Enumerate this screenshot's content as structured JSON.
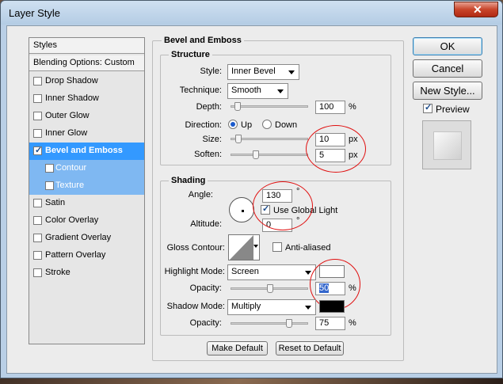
{
  "window": {
    "title": "Layer Style",
    "close_icon": "close-icon"
  },
  "styles": {
    "header": "Styles",
    "blending": "Blending Options: Custom",
    "items": [
      {
        "label": "Drop Shadow",
        "checked": false
      },
      {
        "label": "Inner Shadow",
        "checked": false
      },
      {
        "label": "Outer Glow",
        "checked": false
      },
      {
        "label": "Inner Glow",
        "checked": false
      },
      {
        "label": "Bevel and Emboss",
        "checked": true
      },
      {
        "label": "Contour",
        "checked": false
      },
      {
        "label": "Texture",
        "checked": false
      },
      {
        "label": "Satin",
        "checked": false
      },
      {
        "label": "Color Overlay",
        "checked": false
      },
      {
        "label": "Gradient Overlay",
        "checked": false
      },
      {
        "label": "Pattern Overlay",
        "checked": false
      },
      {
        "label": "Stroke",
        "checked": false
      }
    ]
  },
  "bevel": {
    "title": "Bevel and Emboss",
    "structure": {
      "title": "Structure",
      "style_label": "Style:",
      "style_value": "Inner Bevel",
      "technique_label": "Technique:",
      "technique_value": "Smooth",
      "depth_label": "Depth:",
      "depth_value": "100",
      "depth_unit": "%",
      "direction_label": "Direction:",
      "dir_up": "Up",
      "dir_down": "Down",
      "size_label": "Size:",
      "size_value": "10",
      "size_unit": "px",
      "soften_label": "Soften:",
      "soften_value": "5",
      "soften_unit": "px"
    },
    "shading": {
      "title": "Shading",
      "angle_label": "Angle:",
      "angle_value": "130",
      "angle_unit": "°",
      "global_light": "Use Global Light",
      "altitude_label": "Altitude:",
      "altitude_value": "0",
      "altitude_unit": "°",
      "gloss_label": "Gloss Contour:",
      "anti_aliased": "Anti-aliased",
      "highlight_label": "Highlight Mode:",
      "highlight_value": "Screen",
      "highlight_opacity_label": "Opacity:",
      "highlight_opacity_value": "50",
      "highlight_opacity_unit": "%",
      "shadow_label": "Shadow Mode:",
      "shadow_value": "Multiply",
      "shadow_opacity_label": "Opacity:",
      "shadow_opacity_value": "75",
      "shadow_opacity_unit": "%",
      "highlight_color": "#ffffff",
      "shadow_color": "#000000"
    },
    "make_default": "Make Default",
    "reset_default": "Reset to Default"
  },
  "actions": {
    "ok": "OK",
    "cancel": "Cancel",
    "new_style": "New Style...",
    "preview": "Preview"
  }
}
